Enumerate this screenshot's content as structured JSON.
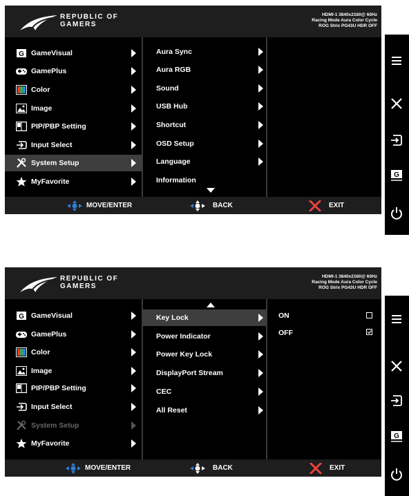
{
  "brand": {
    "line1": "REPUBLIC OF",
    "line2": "GAMERS"
  },
  "status": {
    "line1": "HDMI-1 3840x2160@ 60Hz",
    "line2": "Racing Mode Aura Color Cycle",
    "line3": "ROG Strix PG43U HDR OFF"
  },
  "main_menu": [
    {
      "label": "GameVisual",
      "icon": "gamevisual-icon"
    },
    {
      "label": "GamePlus",
      "icon": "gamepad-icon"
    },
    {
      "label": "Color",
      "icon": "color-icon"
    },
    {
      "label": "Image",
      "icon": "image-icon"
    },
    {
      "label": "PIP/PBP Setting",
      "icon": "pip-icon"
    },
    {
      "label": "Input Select",
      "icon": "input-icon"
    },
    {
      "label": "System Setup",
      "icon": "tools-icon"
    },
    {
      "label": "MyFavorite",
      "icon": "star-icon"
    }
  ],
  "system_setup_page1": [
    "Aura Sync",
    "Aura RGB",
    "Sound",
    "USB Hub",
    "Shortcut",
    "OSD Setup",
    "Language",
    "Information"
  ],
  "system_setup_page2": [
    "Key Lock",
    "Power Indicator",
    "Power Key Lock",
    "DisplayPort Stream",
    "CEC",
    "All Reset"
  ],
  "key_lock_options": [
    {
      "label": "ON",
      "checked": false
    },
    {
      "label": "OFF",
      "checked": true
    }
  ],
  "footer": {
    "move_enter": "MOVE/ENTER",
    "back": "BACK",
    "exit": "EXIT"
  },
  "side_buttons": [
    "menu-icon",
    "close-icon",
    "input-icon",
    "gamevisual-icon",
    "power-icon"
  ],
  "colors": {
    "osd_bg": "#000000",
    "header_bg": "#1e1e1e",
    "selected_bg": "#3e3e3e",
    "nav_blue": "#2e7fd6",
    "exit_red": "#e8433f"
  }
}
